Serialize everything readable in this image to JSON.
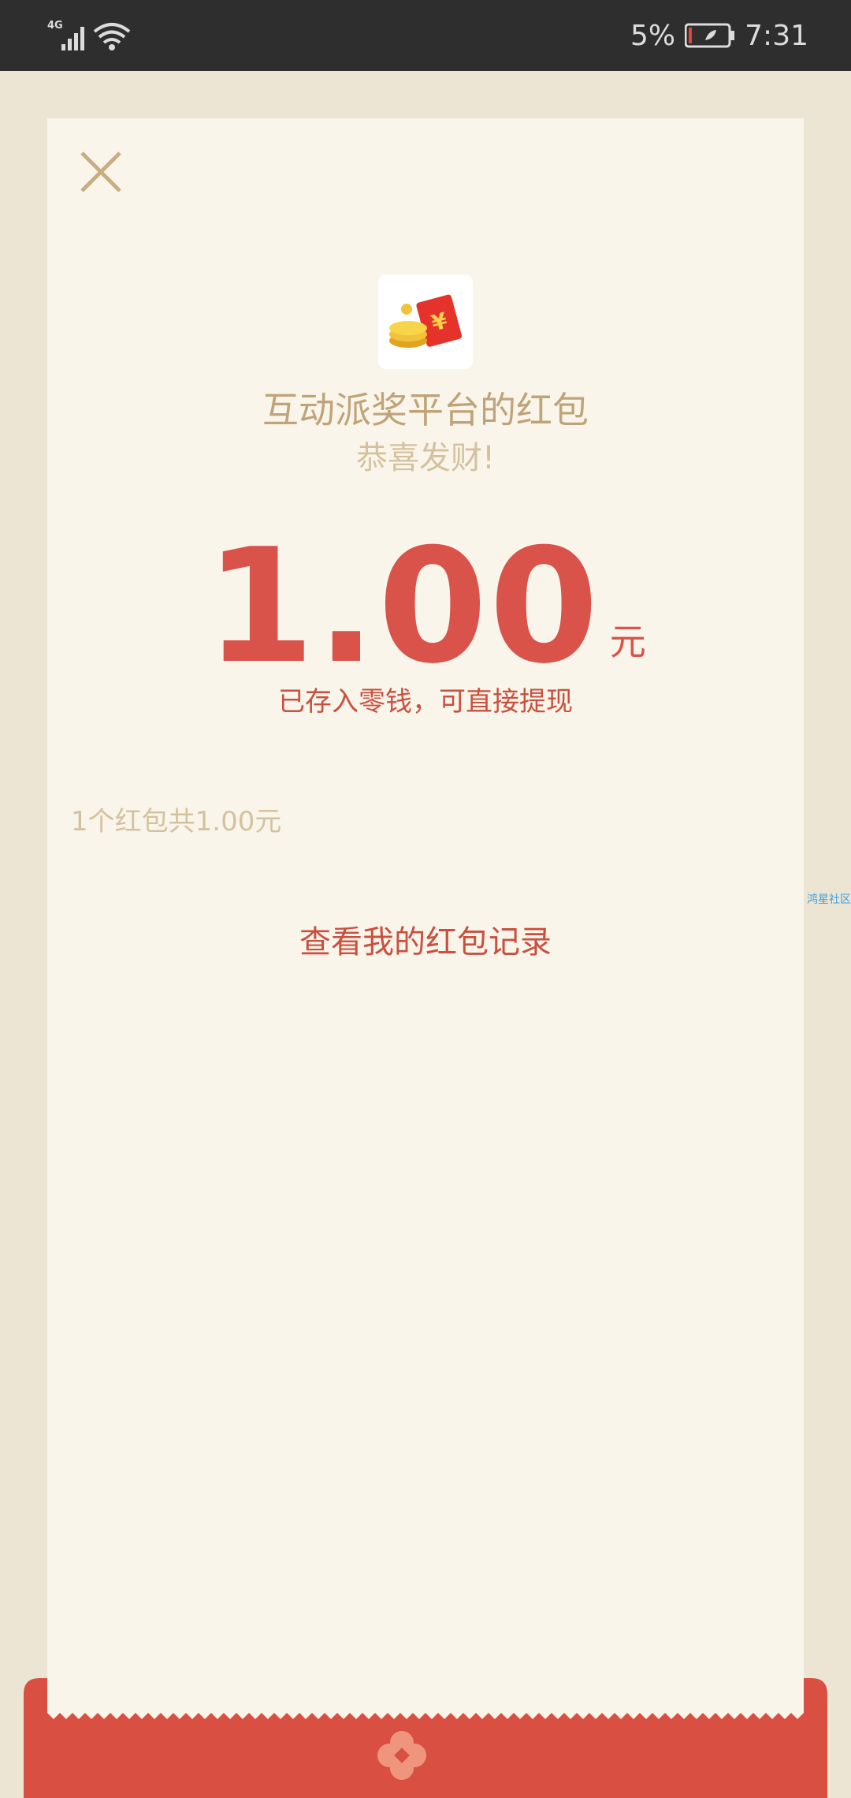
{
  "status_bar": {
    "network": "4G",
    "battery": "5%",
    "time": "7:31"
  },
  "envelope": {
    "close_icon": "close-icon",
    "logo_icon": "red-envelope-coins-icon",
    "sender": "互动派奖平台的红包",
    "blessing": "恭喜发财!",
    "amount": "1.00",
    "unit": "元",
    "note": "已存入零钱，可直接提现",
    "summary": "1个红包共1.00元",
    "history_link": "查看我的红包记录"
  },
  "watermark": "鸿星社区",
  "colors": {
    "accent_red": "#d9534a",
    "gold": "#c0a479",
    "background": "#ede5d3",
    "card": "#faf5ea"
  }
}
